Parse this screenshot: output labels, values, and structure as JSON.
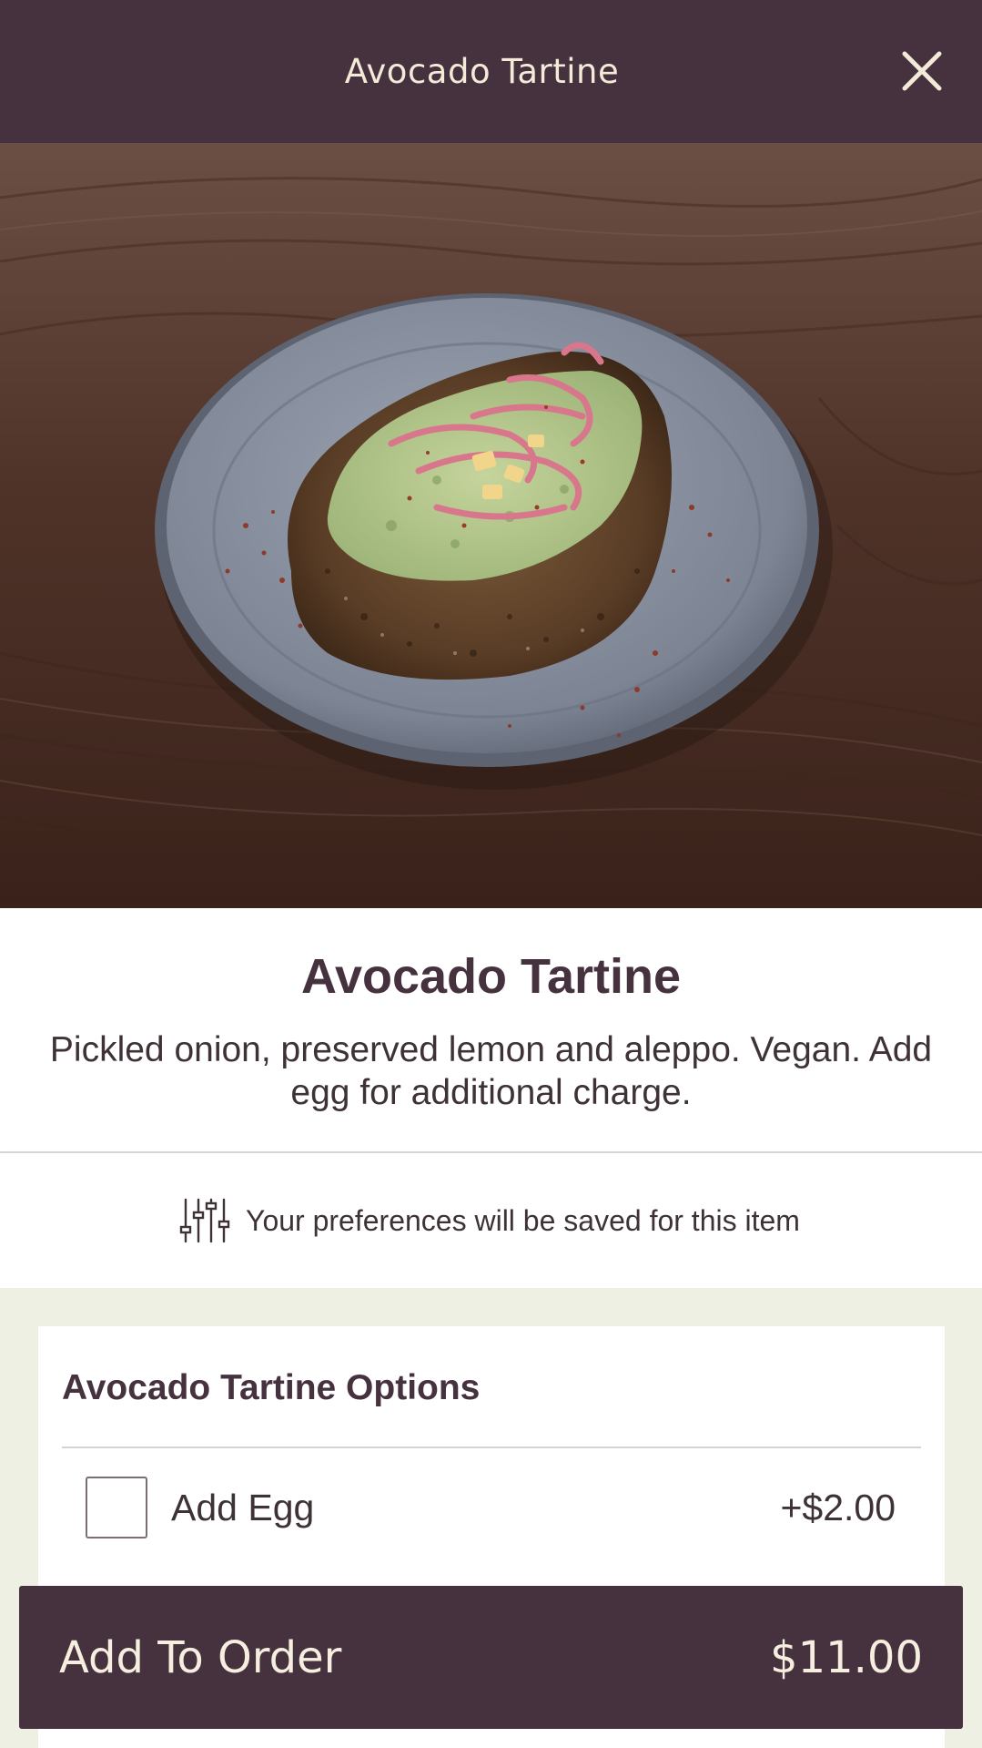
{
  "header": {
    "title": "Avocado Tartine",
    "close_icon": "close-icon"
  },
  "hero": {
    "image": "avocado-tartine-photo"
  },
  "item": {
    "title": "Avocado Tartine",
    "description": "Pickled onion, preserved lemon and aleppo. Vegan. Add egg for additional charge."
  },
  "preferences": {
    "icon": "sliders-icon",
    "text": "Your preferences will be saved for this item"
  },
  "options": {
    "title": "Avocado Tartine Options",
    "items": [
      {
        "label": "Add Egg",
        "price": "+$2.00",
        "checked": false
      }
    ]
  },
  "order_button": {
    "label": "Add To Order",
    "price": "$11.00"
  },
  "colors": {
    "header_bg": "#46323f",
    "header_text": "#f3ead8",
    "body_text": "#3e3238",
    "options_bg": "#eef0e4"
  }
}
